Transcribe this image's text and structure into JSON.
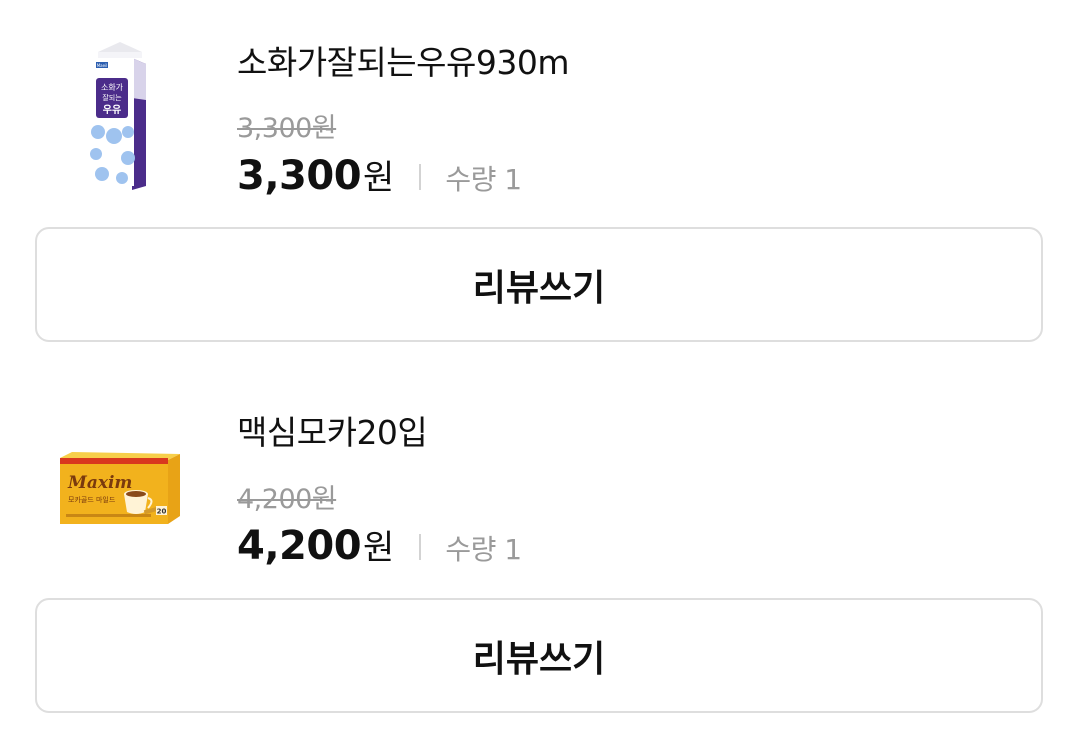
{
  "items": [
    {
      "name": "소화가잘되는우유930m",
      "original_price": "3,300원",
      "price": "3,300",
      "price_unit": "원",
      "quantity": "수량 1",
      "review_label": "리뷰쓰기",
      "image": {
        "brand": "Maeil",
        "title_line1": "소화가",
        "title_line2": "잘되는",
        "title_line3": "우유",
        "box_color": "#4b2c8a"
      }
    },
    {
      "name": "맥심모카20입",
      "original_price": "4,200원",
      "price": "4,200",
      "price_unit": "원",
      "quantity": "수량 1",
      "review_label": "리뷰쓰기",
      "image": {
        "brand": "Maxim",
        "subtitle": "모카골드 마일드",
        "count": "20",
        "box_color": "#f2b21d"
      }
    }
  ]
}
